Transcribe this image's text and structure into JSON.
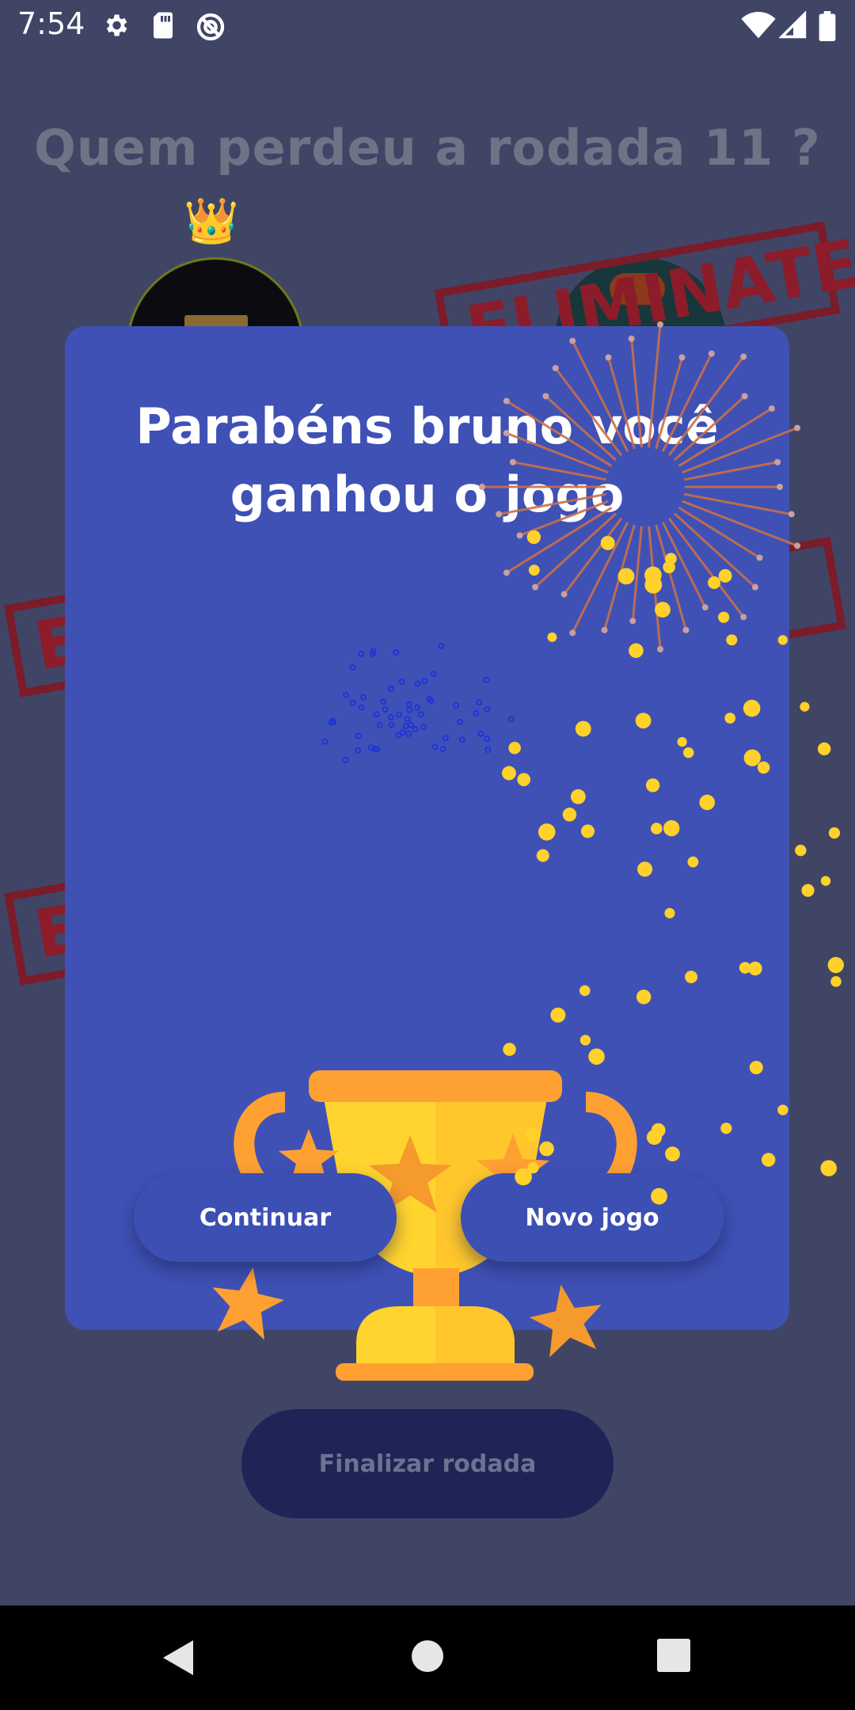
{
  "status_bar": {
    "time": "7:54",
    "left_icons": [
      "settings-icon",
      "sd-card-icon",
      "no-data-icon"
    ],
    "right_icons": [
      "wifi-icon",
      "signal-icon",
      "battery-icon"
    ]
  },
  "background": {
    "round_title": "Quem perdeu a rodada 11 ?",
    "crown_glyph": "👑",
    "stamp_text": "ELIMINATED",
    "stamp_text_partial": "E",
    "finalize_button": "Finalizar rodada"
  },
  "dialog": {
    "title_line1": "Parabéns bruno você",
    "title_line2": "ganhou o jogo",
    "trophy_icon": "trophy-icon",
    "continue_button": "Continuar",
    "new_game_button": "Novo jogo"
  },
  "nav_bar": {
    "back": "back-icon",
    "home": "home-icon",
    "recents": "recents-icon"
  },
  "colors": {
    "screen_bg": "#404566",
    "dialog_bg": "#3f51b5",
    "accent_gold": "#ffd12a",
    "stamp_red": "#8c1c2a",
    "firework_orange": "#c9704a"
  }
}
